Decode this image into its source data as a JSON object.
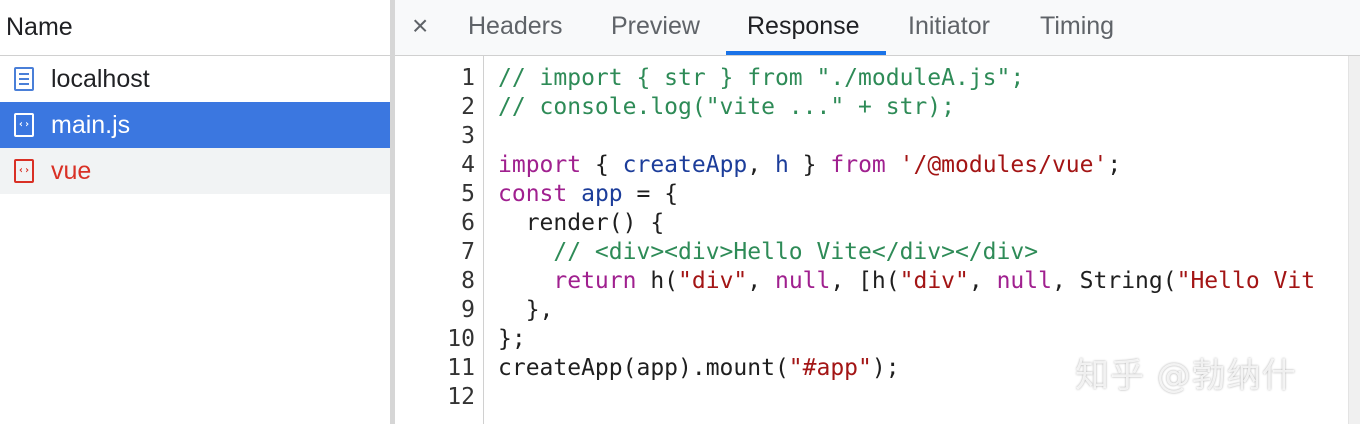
{
  "sidebar": {
    "header": "Name",
    "requests": [
      {
        "name": "localhost",
        "icon": "document-icon"
      },
      {
        "name": "main.js",
        "icon": "script-icon",
        "selected": true
      },
      {
        "name": "vue",
        "icon": "script-icon",
        "error": true
      }
    ]
  },
  "tabs": {
    "close": "×",
    "items": [
      "Headers",
      "Preview",
      "Response",
      "Initiator",
      "Timing"
    ],
    "active": "Response"
  },
  "code": {
    "line_numbers": [
      "1",
      "2",
      "3",
      "4",
      "5",
      "6",
      "7",
      "8",
      "9",
      "10",
      "11",
      "12"
    ],
    "lines": [
      [
        {
          "t": "// import { str } from \"./moduleA.js\";",
          "c": "cm"
        }
      ],
      [
        {
          "t": "// console.log(\"vite ...\" + str);",
          "c": "cm"
        }
      ],
      [],
      [
        {
          "t": "import",
          "c": "kw"
        },
        {
          "t": " { ",
          "c": "df"
        },
        {
          "t": "createApp",
          "c": "nm"
        },
        {
          "t": ", ",
          "c": "df"
        },
        {
          "t": "h",
          "c": "nm"
        },
        {
          "t": " } ",
          "c": "df"
        },
        {
          "t": "from",
          "c": "kw"
        },
        {
          "t": " ",
          "c": "df"
        },
        {
          "t": "'/@modules/vue'",
          "c": "st"
        },
        {
          "t": ";",
          "c": "df"
        }
      ],
      [
        {
          "t": "const",
          "c": "kw"
        },
        {
          "t": " ",
          "c": "df"
        },
        {
          "t": "app",
          "c": "nm"
        },
        {
          "t": " = {",
          "c": "df"
        }
      ],
      [
        {
          "t": "  render() {",
          "c": "df"
        }
      ],
      [
        {
          "t": "    // <div><div>Hello Vite</div></div>",
          "c": "cm"
        }
      ],
      [
        {
          "t": "    ",
          "c": "df"
        },
        {
          "t": "return",
          "c": "kw"
        },
        {
          "t": " h(",
          "c": "df"
        },
        {
          "t": "\"div\"",
          "c": "st"
        },
        {
          "t": ", ",
          "c": "df"
        },
        {
          "t": "null",
          "c": "kw"
        },
        {
          "t": ", [h(",
          "c": "df"
        },
        {
          "t": "\"div\"",
          "c": "st"
        },
        {
          "t": ", ",
          "c": "df"
        },
        {
          "t": "null",
          "c": "kw"
        },
        {
          "t": ", String(",
          "c": "df"
        },
        {
          "t": "\"Hello Vit",
          "c": "st"
        }
      ],
      [
        {
          "t": "  },",
          "c": "df"
        }
      ],
      [
        {
          "t": "};",
          "c": "df"
        }
      ],
      [
        {
          "t": "createApp(app).mount(",
          "c": "df"
        },
        {
          "t": "\"#app\"",
          "c": "st"
        },
        {
          "t": ");",
          "c": "df"
        }
      ],
      []
    ]
  },
  "watermark": "知乎 @勃纳什"
}
